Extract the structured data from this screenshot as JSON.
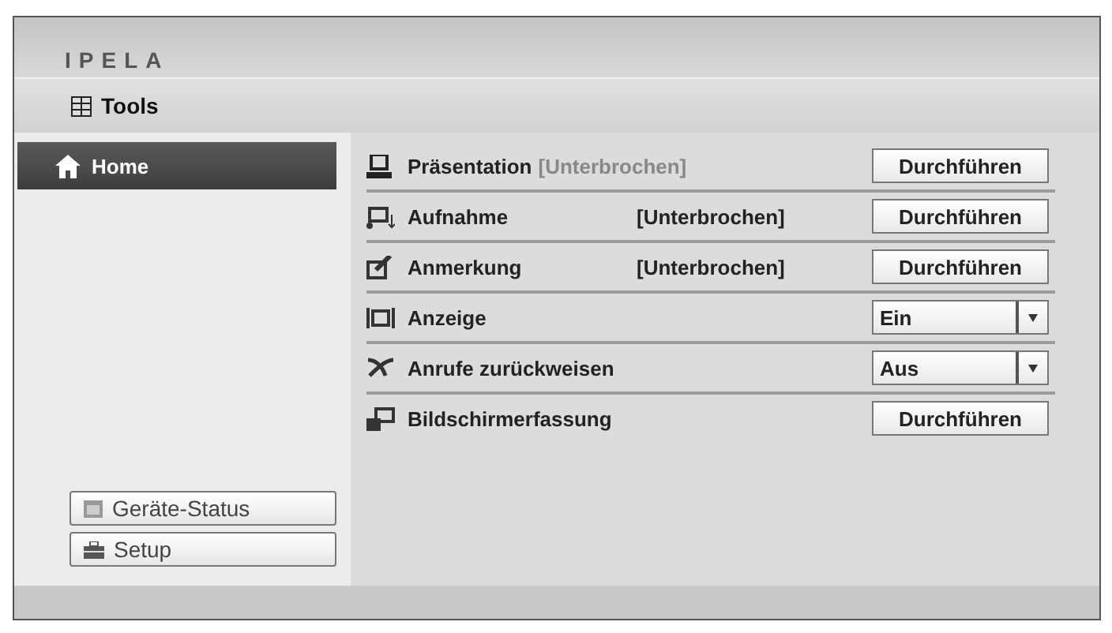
{
  "logo": "IPELA",
  "toolbar": {
    "title": "Tools"
  },
  "sidebar": {
    "items": [
      {
        "label": "Home",
        "selected": true
      }
    ],
    "buttons": [
      {
        "label": "Geräte-Status"
      },
      {
        "label": "Setup"
      }
    ]
  },
  "rows": [
    {
      "label": "Präsentation",
      "status": "[Unterbrochen]",
      "status_greyed": true,
      "kind": "button",
      "control": "Durchführen"
    },
    {
      "label": "Aufnahme",
      "status": "[Unterbrochen]",
      "status_greyed": false,
      "kind": "button",
      "control": "Durchführen"
    },
    {
      "label": "Anmerkung",
      "status": "[Unterbrochen]",
      "status_greyed": false,
      "kind": "button",
      "control": "Durchführen"
    },
    {
      "label": "Anzeige",
      "kind": "dropdown",
      "control": "Ein"
    },
    {
      "label": "Anrufe zurückweisen",
      "kind": "dropdown",
      "control": "Aus"
    },
    {
      "label": "Bildschirmerfassung",
      "kind": "button",
      "control": "Durchführen"
    }
  ]
}
